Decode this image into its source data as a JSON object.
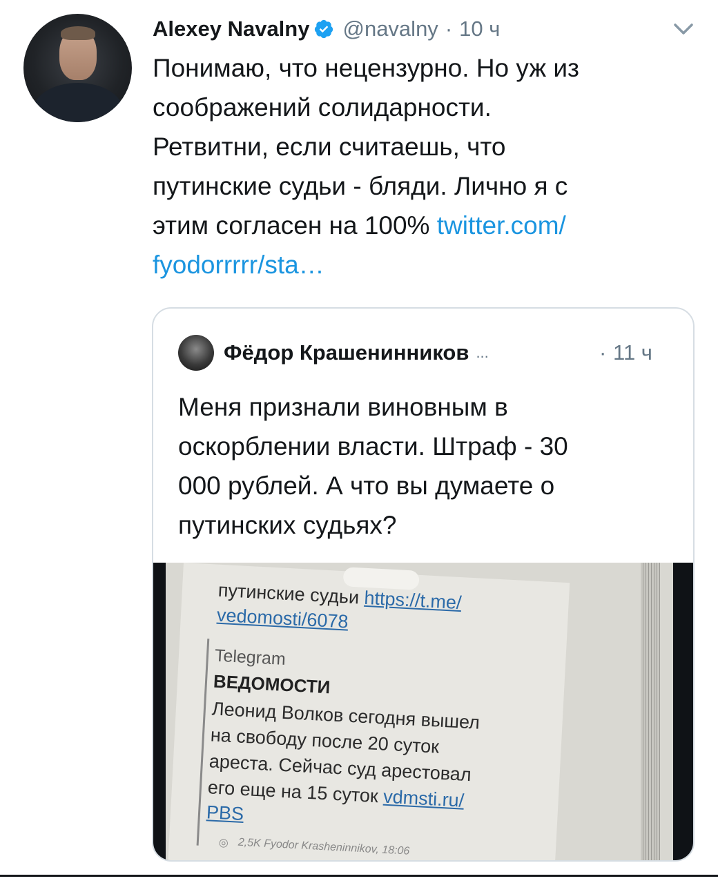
{
  "tweet": {
    "author_name": "Alexey Navalny",
    "handle": "@navalny",
    "separator": "·",
    "time": "10 ч",
    "text_lines": [
      "Понимаю, что нецензурно. Но уж из",
      "соображений солидарности.",
      "Ретвитни, если считаешь, что",
      "путинские судьи - бляди. Лично я с",
      "этим согласен на 100% "
    ],
    "link_part1": "twitter.com/",
    "link_part2": "fyodorrrrr/sta…"
  },
  "quote": {
    "author_name": "Фёдор Крашенинников",
    "ellipsis": "...",
    "separator": "·",
    "time": "11 ч",
    "text_lines": [
      "Меня признали виновным в",
      "оскорблении власти. Штраф - 30",
      "000 рублей. А что вы думаете о",
      "путинских судьях?"
    ],
    "photo": {
      "line1": "путинские судьи ",
      "line1_link": "https://t.me/",
      "line2_link": "vedomosti/6078",
      "channel": "Telegram",
      "title": "ВЕДОМОСТИ",
      "body_lines": [
        "Леонид Волков сегодня вышел",
        "на свободу после 20 суток",
        "ареста. Сейчас суд арестовал",
        "его еще на 15 суток "
      ],
      "body_link": "vdmsti.ru/",
      "body_link2": "PBS",
      "meta": "2,5K Fyodor Krasheninnikov, 18:06"
    }
  },
  "colors": {
    "link": "#1b95e0",
    "verified": "#1da1f2",
    "muted": "#657786",
    "text": "#14171a",
    "border": "#d6dde3"
  },
  "icons": [
    "verified-badge-icon",
    "chevron-down-icon",
    "eye-icon"
  ]
}
